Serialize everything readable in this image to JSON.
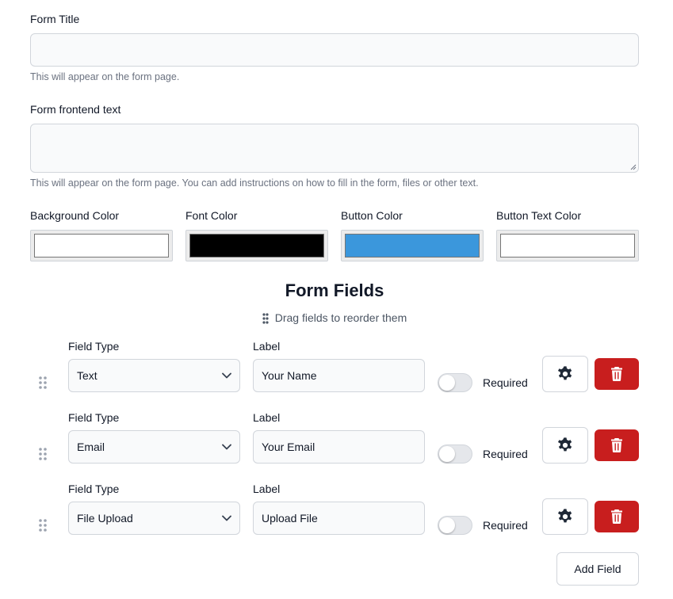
{
  "form_title": {
    "label": "Form Title",
    "value": "",
    "help": "This will appear on the form page."
  },
  "frontend_text": {
    "label": "Form frontend text",
    "value": "",
    "help": "This will appear on the form page. You can add instructions on how to fill in the form, files or other text."
  },
  "colors": [
    {
      "label": "Background Color",
      "value": "#ffffff"
    },
    {
      "label": "Font Color",
      "value": "#000000"
    },
    {
      "label": "Button Color",
      "value": "#3b97dc"
    },
    {
      "label": "Button Text Color",
      "value": "#ffffff"
    }
  ],
  "fields_section": {
    "title": "Form Fields",
    "drag_hint": "Drag fields to reorder them",
    "field_type_label": "Field Type",
    "label_label": "Label",
    "required_label": "Required",
    "rows": [
      {
        "type": "Text",
        "label": "Your Name",
        "required": false
      },
      {
        "type": "Email",
        "label": "Your Email",
        "required": false
      },
      {
        "type": "File Upload",
        "label": "Upload File",
        "required": false
      }
    ],
    "add_button": "Add Field"
  },
  "icons": {
    "drag_handle": "grip-dots-icon",
    "settings": "gear-icon",
    "delete": "trash-icon",
    "dropdown": "chevron-down-icon"
  },
  "accent_colors": {
    "delete_button": "#c81e1e"
  }
}
